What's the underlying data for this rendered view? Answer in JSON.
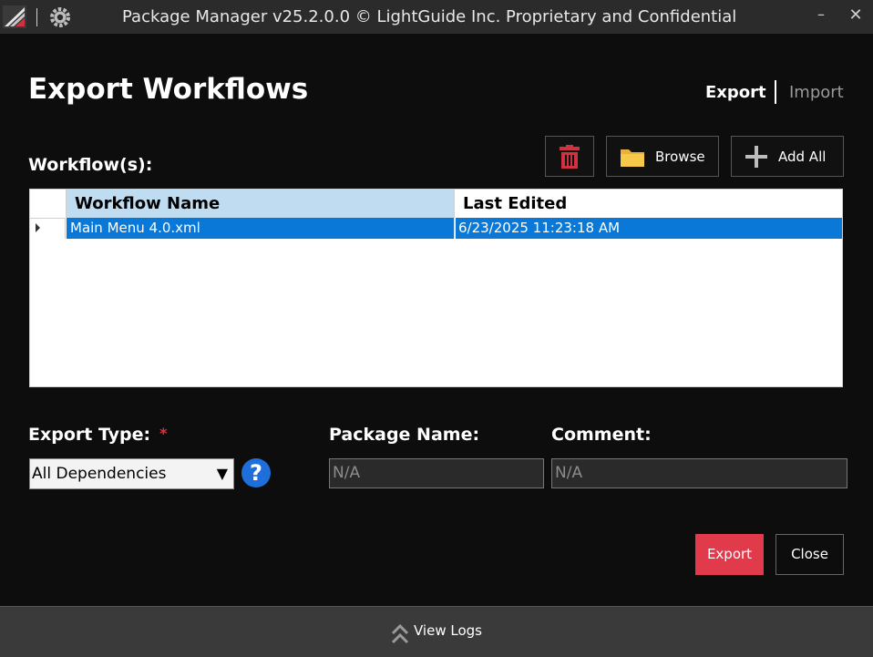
{
  "window": {
    "title": "Package Manager v25.2.0.0 © LightGuide Inc. Proprietary and Confidential",
    "minimize_glyph": "–",
    "close_glyph": "✕"
  },
  "header": {
    "title": "Export Workflows",
    "mode_export": "Export",
    "mode_import": "Import"
  },
  "workflows": {
    "label": "Workflow(s):",
    "toolbar": {
      "browse_label": "Browse",
      "add_all_label": "Add All"
    },
    "columns": [
      "Workflow Name",
      "Last Edited"
    ],
    "rows": [
      {
        "name": "Main Menu 4.0.xml",
        "last_edited": "6/23/2025 11:23:18 AM",
        "selected": true
      }
    ]
  },
  "form": {
    "export_type_label": "Export Type:",
    "required_marker": "*",
    "export_type_value": "All Dependencies",
    "dropdown_glyph": "▼",
    "help_glyph": "?",
    "package_name_label": "Package Name:",
    "package_name_value": "N/A",
    "comment_label": "Comment:",
    "comment_value": "N/A"
  },
  "actions": {
    "export_label": "Export",
    "close_label": "Close"
  },
  "footer": {
    "view_logs_label": "View Logs"
  },
  "colors": {
    "accent_red": "#e03a4b",
    "selection_blue": "#0a78d7",
    "help_blue": "#1e6fd9",
    "header_blue": "#c0dcf0"
  }
}
